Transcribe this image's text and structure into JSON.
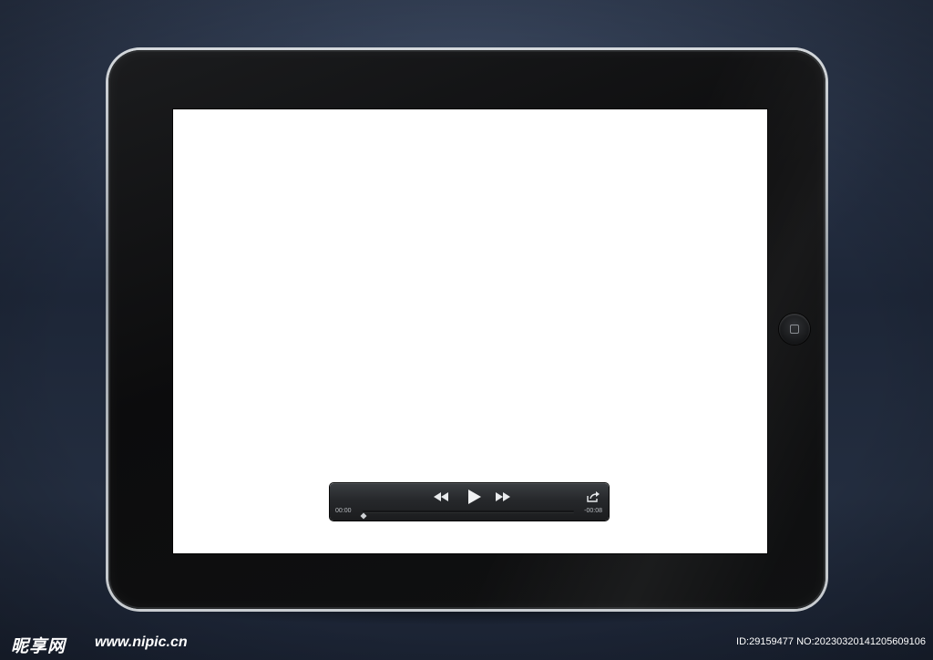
{
  "device": {
    "type": "tablet",
    "screen_color": "#ffffff",
    "bezel_color": "#0f1011",
    "frame_color": "#c4c8cc"
  },
  "player": {
    "elapsed": "00:00",
    "remaining": "-00:08",
    "progress": 0,
    "icons": {
      "rewind": "rewind-icon",
      "play": "play-icon",
      "forward": "fast-forward-icon",
      "share": "share-icon"
    }
  },
  "watermark": {
    "logo": "昵享网",
    "url": "www.nipic.cn",
    "id_text": "ID:29159477 NO:20230320141205609106"
  },
  "colors": {
    "background_top": "#2f3b52",
    "background_bottom": "#1a2232",
    "control_text": "#b7bbbf"
  }
}
